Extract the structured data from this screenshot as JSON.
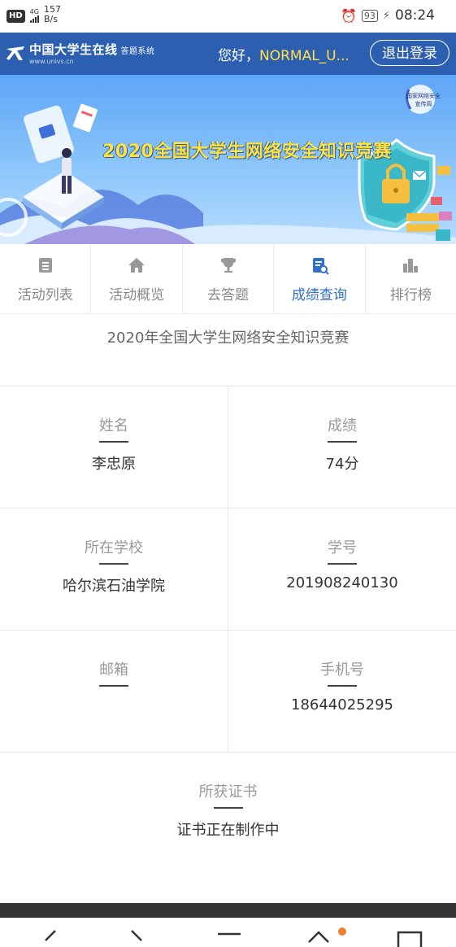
{
  "status_bar": {
    "hd": "HD",
    "network": "4G",
    "speed_value": "157",
    "speed_unit": "B/s",
    "battery": "93",
    "time": "08:24"
  },
  "header": {
    "logo_text": "中国大学生在线",
    "logo_sub": "答题系统",
    "logo_url": "www.univs.cn",
    "greeting_prefix": "您好，",
    "username": "NORMAL_U...",
    "logout_label": "退出登录"
  },
  "banner": {
    "title": "2020全国大学生网络安全知识竞赛",
    "seal_text_1": "国家网络安全",
    "seal_text_2": "宣传周"
  },
  "tabs": [
    {
      "label": "活动列表",
      "icon": "list-icon",
      "active": false
    },
    {
      "label": "活动概览",
      "icon": "home-icon",
      "active": false
    },
    {
      "label": "去答题",
      "icon": "trophy-icon",
      "active": false
    },
    {
      "label": "成绩查询",
      "icon": "score-search-icon",
      "active": true
    },
    {
      "label": "排行榜",
      "icon": "ranking-icon",
      "active": false
    }
  ],
  "competition_title": "2020年全国大学生网络安全知识竞赛",
  "result": {
    "name_label": "姓名",
    "name_value": "李忠原",
    "score_label": "成绩",
    "score_value": "74分",
    "school_label": "所在学校",
    "school_value": "哈尔滨石油学院",
    "student_id_label": "学号",
    "student_id_value": "201908240130",
    "email_label": "邮箱",
    "email_value": "",
    "phone_label": "手机号",
    "phone_value": "18644025295",
    "certificate_label": "所获证书",
    "certificate_value": "证书正在制作中"
  },
  "colors": {
    "header_bg": "#2d5fb0",
    "active_tab": "#2f6fd0",
    "banner_title": "#ffe23a",
    "username": "#ffe14a"
  }
}
